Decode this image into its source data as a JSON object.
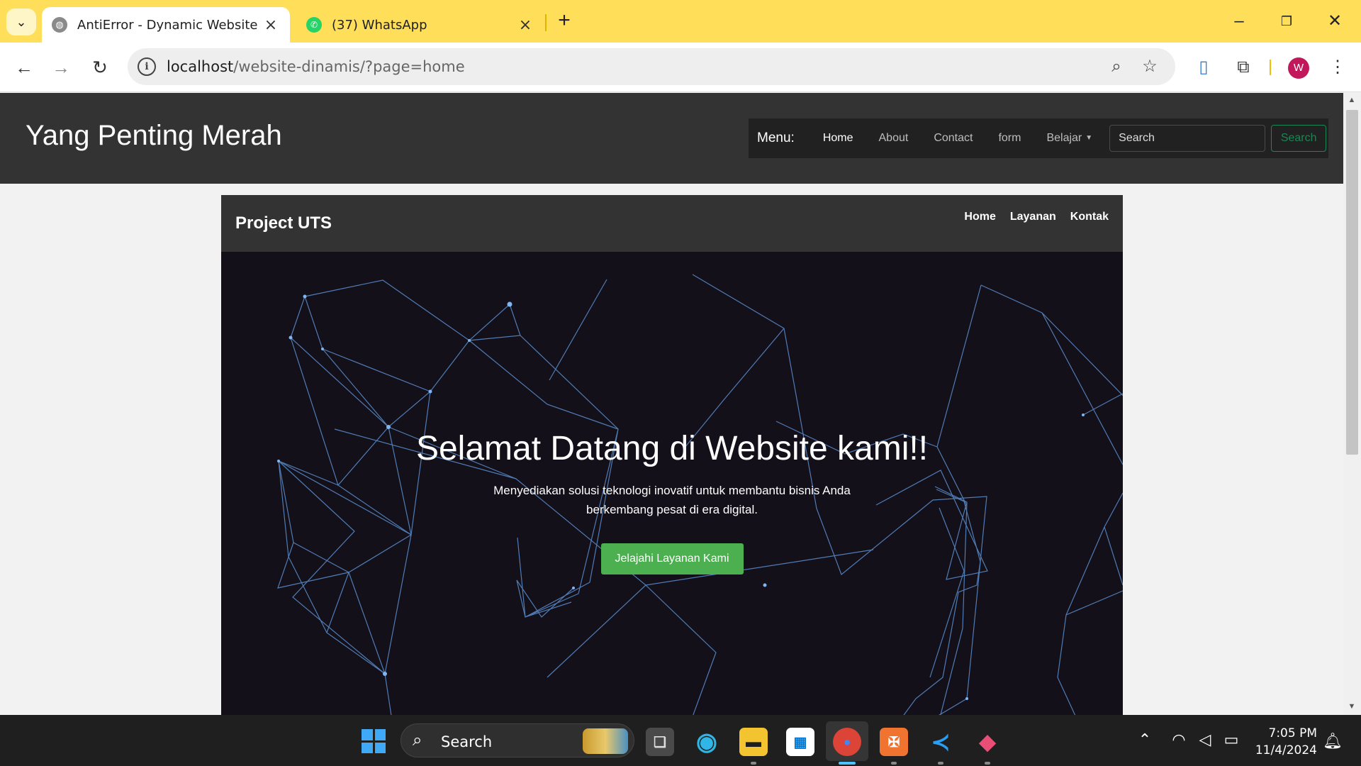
{
  "browser": {
    "tabs": [
      {
        "title": "AntiError - Dynamic Website",
        "active": true,
        "favicon": "globe-icon"
      },
      {
        "title": "(37) WhatsApp",
        "active": false,
        "favicon": "whatsapp-icon"
      }
    ],
    "url_host": "localhost",
    "url_path": "/website-dinamis/?page=home",
    "profile_initial": "W",
    "accent_color": "#ffde59"
  },
  "site": {
    "title": "Yang Penting Merah",
    "menu_label": "Menu:",
    "menu_items": [
      "Home",
      "About",
      "Contact",
      "form",
      "Belajar"
    ],
    "search_placeholder": "Search",
    "search_button": "Search"
  },
  "content": {
    "brand": "Project UTS",
    "nav_links": [
      "Home",
      "Layanan",
      "Kontak"
    ],
    "hero_title": "Selamat Datang di Website kami!!",
    "hero_subtitle": "Menyediakan solusi teknologi inovatif untuk membantu bisnis Anda berkembang pesat di era digital.",
    "hero_button": "Jelajahi Layanan Kami",
    "button_color": "#4caf50"
  },
  "taskbar": {
    "search_label": "Search",
    "time": "7:05 PM",
    "date": "11/4/2024"
  }
}
